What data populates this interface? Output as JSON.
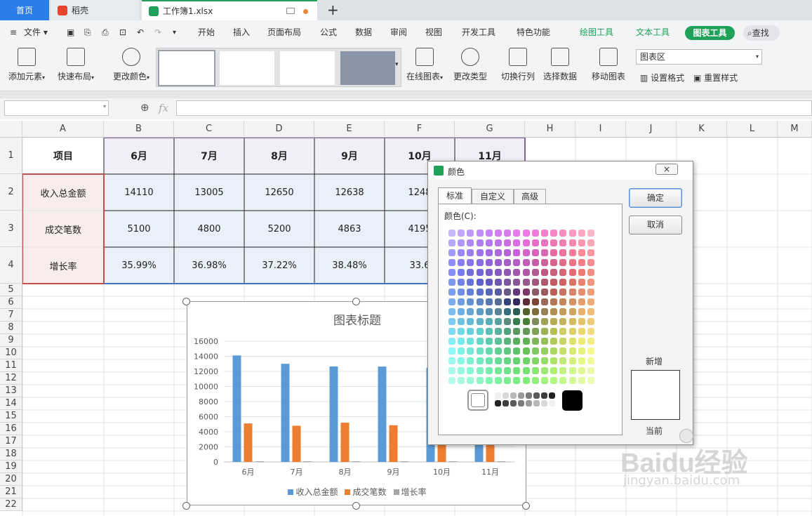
{
  "tabs": [
    {
      "label": "首页"
    },
    {
      "label": "稻壳"
    },
    {
      "label": "工作簿1.xlsx"
    }
  ],
  "new_tab": "+",
  "menu": {
    "file": "文件",
    "items": [
      "开始",
      "插入",
      "页面布局",
      "公式",
      "数据",
      "审阅",
      "视图",
      "开发工具",
      "特色功能"
    ],
    "context": [
      "绘图工具",
      "文本工具"
    ],
    "active_context": "图表工具",
    "search": "查找"
  },
  "ribbon": {
    "add_element": "添加元素",
    "quick_layout": "快速布局",
    "change_color": "更改颜色",
    "online_chart": "在线图表",
    "change_type": "更改类型",
    "switch_rowcol": "切换行列",
    "select_data": "选择数据",
    "move_chart": "移动图表",
    "area_select": "图表区",
    "set_format": "设置格式",
    "reset_style": "重置样式"
  },
  "formula": {
    "fx": "fx"
  },
  "columns": [
    "A",
    "B",
    "C",
    "D",
    "E",
    "F",
    "G",
    "H",
    "I",
    "J",
    "K",
    "L",
    "M"
  ],
  "rows": [
    "1",
    "2",
    "3",
    "4",
    "5",
    "6",
    "7",
    "8",
    "9",
    "10",
    "11",
    "12",
    "13",
    "14",
    "15",
    "16",
    "17",
    "18",
    "19",
    "20",
    "21",
    "22"
  ],
  "table": {
    "header": [
      "项目",
      "6月",
      "7月",
      "8月",
      "9月",
      "10月",
      "11月"
    ],
    "rows": [
      [
        "收入总金额",
        "14110",
        "13005",
        "12650",
        "12638",
        "1248"
      ],
      [
        "成交笔数",
        "5100",
        "4800",
        "5200",
        "4863",
        "4195"
      ],
      [
        "增长率",
        "35.99%",
        "36.98%",
        "37.22%",
        "38.48%",
        "33.6"
      ]
    ]
  },
  "dialog": {
    "title": "颜色",
    "close": "×",
    "tabs": [
      "标准",
      "自定义",
      "高级"
    ],
    "colors_label": "颜色(C):",
    "ok": "确定",
    "cancel": "取消",
    "new_label": "新增",
    "current_label": "当前"
  },
  "chart_data": {
    "type": "bar",
    "title": "图表标题",
    "categories": [
      "6月",
      "7月",
      "8月",
      "9月",
      "10月",
      "11月"
    ],
    "series": [
      {
        "name": "收入总金额",
        "values": [
          14110,
          13005,
          12650,
          12638,
          12480,
          12300
        ],
        "color": "#5b9bd5"
      },
      {
        "name": "成交笔数",
        "values": [
          5100,
          4800,
          5200,
          4863,
          4195,
          4300
        ],
        "color": "#ed7d31"
      },
      {
        "name": "增长率",
        "values": [
          0.3599,
          0.3698,
          0.3722,
          0.3848,
          0.336,
          0.34
        ],
        "color": "#a5a5a5"
      }
    ],
    "ylim": [
      0,
      16000
    ],
    "yticks": [
      "16000",
      "14000",
      "12000",
      "10000",
      "8000",
      "6000",
      "4000",
      "2000",
      "0"
    ],
    "legend": "bottom",
    "grid": true
  },
  "watermark": {
    "brand": "Baidu经验",
    "url": "jingyan.baidu.com"
  },
  "colors": {
    "accent": "#2b7de9",
    "green": "#1fa15a",
    "header_bg": "#f1eef8",
    "data_bg": "#eaf0fa",
    "label_bg": "#f9ecec"
  }
}
